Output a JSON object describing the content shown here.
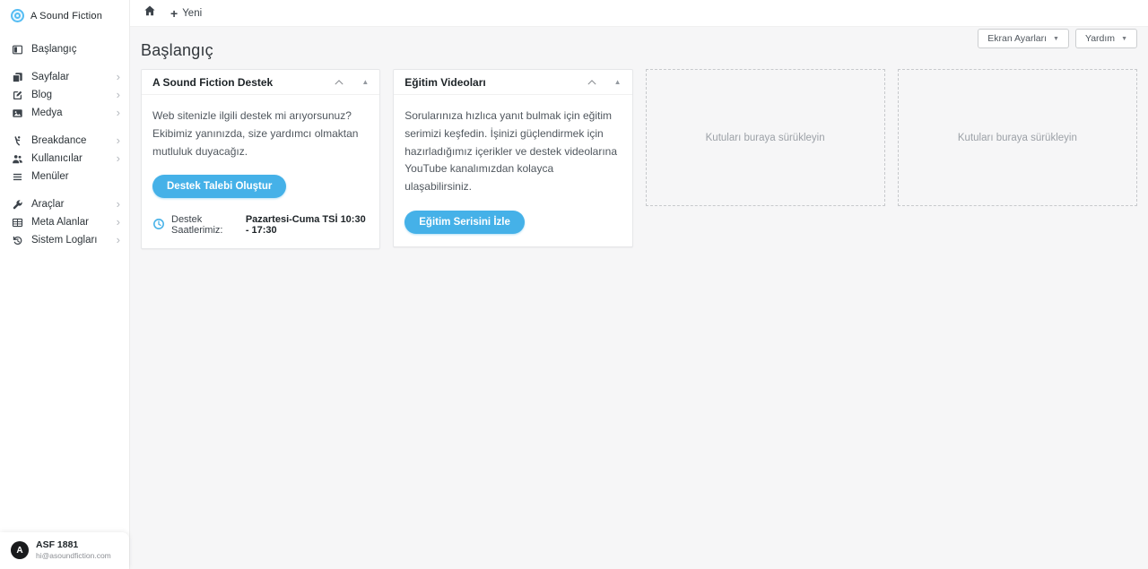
{
  "brand": {
    "name": "A Sound Fiction",
    "logo_icon": "concentric-circles-logo"
  },
  "topbar": {
    "home_icon": "home-icon",
    "plus_glyph": "+",
    "new_label": "Yeni"
  },
  "sidebar": {
    "groups": [
      {
        "items": [
          {
            "label": "Başlangıç",
            "icon": "dashboard-icon",
            "has_submenu": false
          }
        ]
      },
      {
        "items": [
          {
            "label": "Sayfalar",
            "icon": "pages-icon",
            "has_submenu": true
          },
          {
            "label": "Blog",
            "icon": "edit-icon",
            "has_submenu": true
          },
          {
            "label": "Medya",
            "icon": "media-icon",
            "has_submenu": true
          }
        ]
      },
      {
        "items": [
          {
            "label": "Breakdance",
            "icon": "breakdance-icon",
            "has_submenu": true
          },
          {
            "label": "Kullanıcılar",
            "icon": "users-icon",
            "has_submenu": true
          },
          {
            "label": "Menüler",
            "icon": "menu-list-icon",
            "has_submenu": false
          }
        ]
      },
      {
        "items": [
          {
            "label": "Araçlar",
            "icon": "wrench-icon",
            "has_submenu": true
          },
          {
            "label": "Meta Alanlar",
            "icon": "table-icon",
            "has_submenu": true
          },
          {
            "label": "Sistem Logları",
            "icon": "history-icon",
            "has_submenu": true
          }
        ]
      }
    ],
    "user": {
      "name": "ASF 1881",
      "email": "hi@asoundfiction.com",
      "avatar_letter": "A"
    }
  },
  "page": {
    "title": "Başlangıç",
    "screen_options_label": "Ekran Ayarları",
    "help_label": "Yardım"
  },
  "widgets": {
    "support": {
      "title": "A Sound Fiction Destek",
      "body": "Web sitenizle ilgili destek mi arıyorsunuz? Ekibimiz yanınızda, size yardımcı olmaktan mutluluk duyacağız.",
      "button_label": "Destek Talebi Oluştur",
      "hours_icon": "clock-icon",
      "hours_label": "Destek Saatlerimiz:",
      "hours_value": "Pazartesi-Cuma TSİ 10:30 - 17:30"
    },
    "videos": {
      "title": "Eğitim Videoları",
      "body": "Sorularınıza hızlıca yanıt bulmak için eğitim serimizi keşfedin. İşinizi güçlendirmek için hazırladığımız içerikler ve destek videolarına YouTube kanalımızdan kolayca ulaşabilirsiniz.",
      "button_label": "Eğitim Serisini İzle"
    }
  },
  "dropzones": {
    "placeholder": "Kutuları buraya sürükleyin"
  },
  "colors": {
    "accent_blue": "#45b1e8",
    "logo_blue": "#56bdf3",
    "background": "#f6f6f7",
    "sidebar_bg": "#ffffff",
    "text_dark": "#1d2327",
    "text_body": "#50575e"
  }
}
